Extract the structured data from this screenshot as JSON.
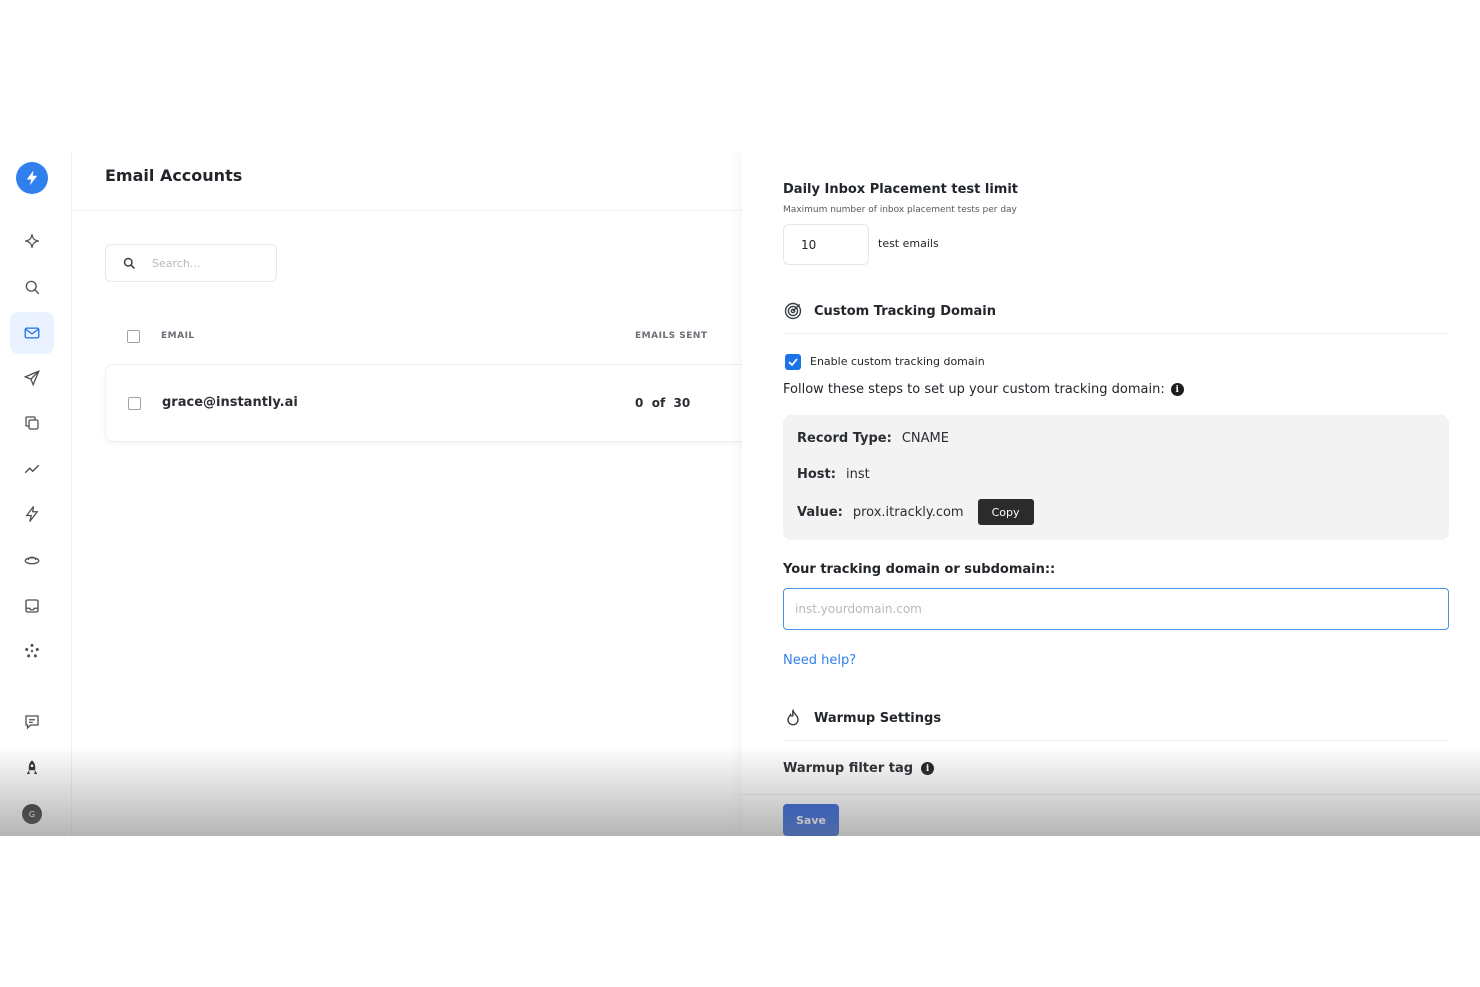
{
  "sidebar": {
    "logo_icon": "lightning-bolt-icon",
    "items": [
      {
        "icon": "sparkle-icon"
      },
      {
        "icon": "search-icon"
      },
      {
        "icon": "mail-icon",
        "active": true
      },
      {
        "icon": "send-icon"
      },
      {
        "icon": "copy-icon"
      },
      {
        "icon": "trend-icon"
      },
      {
        "icon": "bolt-outline-icon"
      },
      {
        "icon": "spaceship-icon"
      },
      {
        "icon": "inbox-icon"
      },
      {
        "icon": "nodes-icon"
      },
      {
        "icon": "feedback-icon"
      },
      {
        "icon": "rocket-icon"
      }
    ],
    "avatar_initial": "G"
  },
  "main": {
    "title": "Email Accounts",
    "search_placeholder": "Search...",
    "columns": {
      "email": "EMAIL",
      "emails_sent": "EMAILS SENT"
    },
    "rows": [
      {
        "email": "grace@instantly.ai",
        "emails_sent": "0  of  30"
      }
    ]
  },
  "panel": {
    "daily_limit": {
      "title": "Daily Inbox Placement test limit",
      "subtitle": "Maximum number of inbox placement tests per day",
      "value": "10",
      "suffix": "test emails"
    },
    "tracking": {
      "title": "Custom Tracking Domain",
      "checkbox_label": "Enable custom tracking domain",
      "steps_text": "Follow these steps to set up your custom tracking domain:",
      "record_type_label": "Record Type:",
      "record_type_value": "CNAME",
      "host_label": "Host:",
      "host_value": "inst",
      "value_label": "Value:",
      "value_value": "prox.itrackly.com",
      "copy_label": "Copy",
      "domain_label": "Your tracking domain or subdomain::",
      "domain_placeholder": "inst.yourdomain.com",
      "help_link": "Need help?"
    },
    "warmup": {
      "title": "Warmup Settings",
      "filter_tag_label": "Warmup filter tag"
    },
    "save_label": "Save",
    "info_glyph": "i"
  },
  "colors": {
    "accent": "#1a73e8",
    "save": "#1a56db",
    "link": "#2f80ed"
  }
}
